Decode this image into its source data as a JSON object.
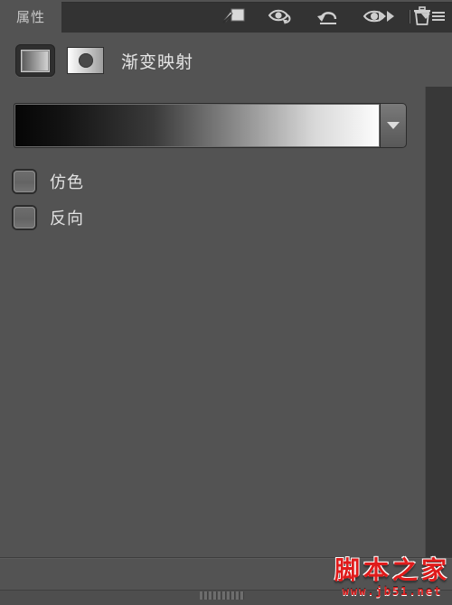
{
  "panel": {
    "tab_label": "属性",
    "title": "渐变映射",
    "header_icons": {
      "collapse": "double-chevron-right-icon",
      "menu": "panel-menu-icon"
    },
    "adjustment_icon": "gradient-map-thumbnail-icon",
    "preset_icon": "adjustment-preset-icon"
  },
  "gradient": {
    "name": "black-to-white-gradient",
    "stops": [
      {
        "position": 0,
        "color": "#050505"
      },
      {
        "position": 100,
        "color": "#fdfdfd"
      }
    ],
    "dropdown_icon": "chevron-down-icon"
  },
  "options": [
    {
      "label": "仿色",
      "name": "dither-checkbox",
      "checked": false
    },
    {
      "label": "反向",
      "name": "reverse-checkbox",
      "checked": false
    }
  ],
  "bottom_toolbar": {
    "buttons": [
      {
        "name": "clip-to-layer-button",
        "icon": "clip-to-layer-icon"
      },
      {
        "name": "toggle-layer-visibility-button",
        "icon": "eye-toggle-icon"
      },
      {
        "name": "reset-adjustment-button",
        "icon": "reset-arrow-icon"
      },
      {
        "name": "preview-visibility-button",
        "icon": "eye-icon"
      },
      {
        "name": "delete-adjustment-layer-button",
        "icon": "trash-icon"
      }
    ]
  },
  "watermark": {
    "text": "脚本之家",
    "url": "www.jb51.net",
    "color": "#e01b1b"
  },
  "resize_grip": "panel-resize-grip"
}
